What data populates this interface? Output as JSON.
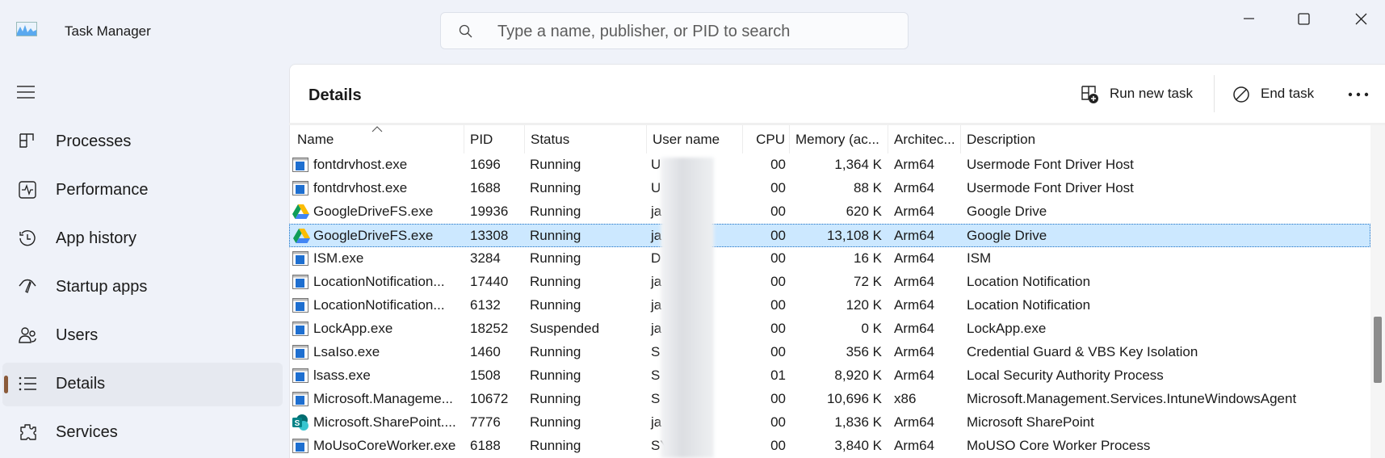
{
  "window": {
    "title": "Task Manager",
    "app_icon": "performance-graph-icon"
  },
  "search": {
    "placeholder": "Type a name, publisher, or PID to search"
  },
  "sidebar": {
    "items": [
      {
        "label": "Processes",
        "icon": "processes-grid-icon"
      },
      {
        "label": "Performance",
        "icon": "performance-pulse-icon"
      },
      {
        "label": "App history",
        "icon": "history-clock-icon"
      },
      {
        "label": "Startup apps",
        "icon": "startup-gauge-icon"
      },
      {
        "label": "Users",
        "icon": "users-icon"
      },
      {
        "label": "Details",
        "icon": "list-icon",
        "active": true
      },
      {
        "label": "Services",
        "icon": "services-puzzle-icon"
      }
    ]
  },
  "panel": {
    "title": "Details",
    "run_new_task": "Run new task",
    "end_task": "End task"
  },
  "table": {
    "columns": [
      "Name",
      "PID",
      "Status",
      "User name",
      "CPU",
      "Memory (ac...",
      "Architec...",
      "Description"
    ],
    "sort": "Name ascending",
    "rows": [
      {
        "name": "fontdrvhost.exe",
        "pid": "1696",
        "status": "Running",
        "user": "U",
        "cpu": "00",
        "mem": "1,364 K",
        "arch": "Arm64",
        "desc": "Usermode Font Driver Host",
        "icon": "app"
      },
      {
        "name": "fontdrvhost.exe",
        "pid": "1688",
        "status": "Running",
        "user": "U",
        "cpu": "00",
        "mem": "88 K",
        "arch": "Arm64",
        "desc": "Usermode Font Driver Host",
        "icon": "app"
      },
      {
        "name": "GoogleDriveFS.exe",
        "pid": "19936",
        "status": "Running",
        "user": "ja",
        "cpu": "00",
        "mem": "620 K",
        "arch": "Arm64",
        "desc": "Google Drive",
        "icon": "gdrive"
      },
      {
        "name": "GoogleDriveFS.exe",
        "pid": "13308",
        "status": "Running",
        "user": "ja",
        "cpu": "00",
        "mem": "13,108 K",
        "arch": "Arm64",
        "desc": "Google Drive",
        "icon": "gdrive",
        "selected": true
      },
      {
        "name": "ISM.exe",
        "pid": "3284",
        "status": "Running",
        "user": "D",
        "cpu": "00",
        "mem": "16 K",
        "arch": "Arm64",
        "desc": "ISM",
        "icon": "app"
      },
      {
        "name": "LocationNotification...",
        "pid": "17440",
        "status": "Running",
        "user": "ja",
        "cpu": "00",
        "mem": "72 K",
        "arch": "Arm64",
        "desc": "Location Notification",
        "icon": "app"
      },
      {
        "name": "LocationNotification...",
        "pid": "6132",
        "status": "Running",
        "user": "ja",
        "cpu": "00",
        "mem": "120 K",
        "arch": "Arm64",
        "desc": "Location Notification",
        "icon": "app"
      },
      {
        "name": "LockApp.exe",
        "pid": "18252",
        "status": "Suspended",
        "user": "ja",
        "cpu": "00",
        "mem": "0 K",
        "arch": "Arm64",
        "desc": "LockApp.exe",
        "icon": "app"
      },
      {
        "name": "LsaIso.exe",
        "pid": "1460",
        "status": "Running",
        "user": "S",
        "cpu": "00",
        "mem": "356 K",
        "arch": "Arm64",
        "desc": "Credential Guard & VBS Key Isolation",
        "icon": "app"
      },
      {
        "name": "lsass.exe",
        "pid": "1508",
        "status": "Running",
        "user": "S",
        "cpu": "01",
        "mem": "8,920 K",
        "arch": "Arm64",
        "desc": "Local Security Authority Process",
        "icon": "app"
      },
      {
        "name": "Microsoft.Manageme...",
        "pid": "10672",
        "status": "Running",
        "user": "S",
        "cpu": "00",
        "mem": "10,696 K",
        "arch": "x86",
        "desc": "Microsoft.Management.Services.IntuneWindowsAgent",
        "icon": "app"
      },
      {
        "name": "Microsoft.SharePoint....",
        "pid": "7776",
        "status": "Running",
        "user": "ja",
        "cpu": "00",
        "mem": "1,836 K",
        "arch": "Arm64",
        "desc": "Microsoft SharePoint",
        "icon": "sharepoint"
      },
      {
        "name": "MoUsoCoreWorker.exe",
        "pid": "6188",
        "status": "Running",
        "user": "SYSTEM",
        "cpu": "00",
        "mem": "3,840 K",
        "arch": "Arm64",
        "desc": "MoUSO Core Worker Process",
        "icon": "app"
      }
    ]
  },
  "colors": {
    "selection": "#cce8ff",
    "active_indicator": "#8a5a3a",
    "gdrive": [
      "#0f9d58",
      "#fbbc04",
      "#4285f4"
    ],
    "sharepoint": "#038387"
  }
}
